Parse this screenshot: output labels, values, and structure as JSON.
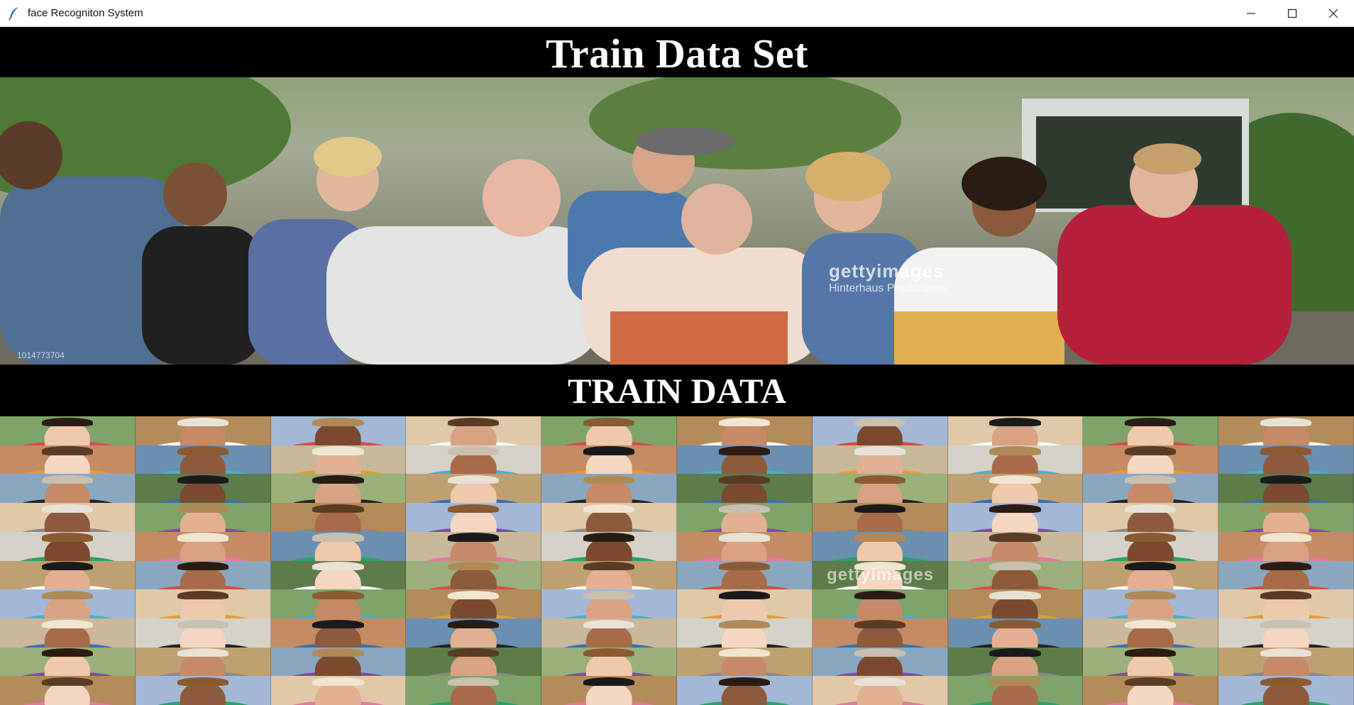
{
  "window": {
    "title": "face Recogniton System",
    "controls": [
      "minimize",
      "maximize",
      "close"
    ]
  },
  "header": {
    "title": "Train Data Set"
  },
  "banner": {
    "watermark_brand": "gettyimages",
    "watermark_credit": "Hinterhaus Productions",
    "image_id": "1014773704"
  },
  "section": {
    "title": "TRAIN DATA"
  },
  "grid": {
    "columns": 10,
    "rows": 10,
    "watermark_brand": "gettyimages"
  },
  "colors": {
    "background": "#000000",
    "header_text": "#ffffff",
    "titlebar": "#ffffff"
  }
}
